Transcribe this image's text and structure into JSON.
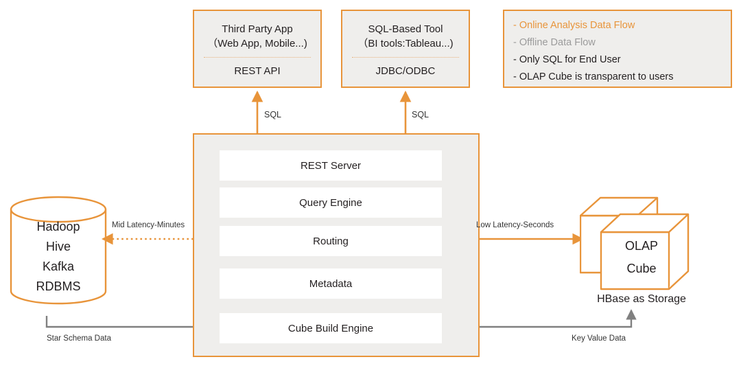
{
  "clients": [
    {
      "title_line1": "Third Party App",
      "title_line2": "（Web App, Mobile...)",
      "interface": "REST API",
      "arrow_label": "SQL"
    },
    {
      "title_line1": "SQL-Based Tool",
      "title_line2": "（BI tools:Tableau...)",
      "interface": "JDBC/ODBC",
      "arrow_label": "SQL"
    }
  ],
  "legend": {
    "items": [
      {
        "text": "- Online Analysis Data Flow",
        "color": "#e8943a",
        "arrow": "double-arrow-orange"
      },
      {
        "text": "- Offline Data Flow",
        "color": "#9b9b9b",
        "arrow": "double-arrow-gray"
      },
      {
        "text": "- Only SQL for End User",
        "color": "#231f20",
        "arrow": "none"
      },
      {
        "text": "- OLAP Cube is transparent to users",
        "color": "#231f20",
        "arrow": "none"
      }
    ]
  },
  "main_container": {
    "layers": [
      "REST Server",
      "Query Engine",
      "Routing",
      "Metadata",
      "Cube Build Engine"
    ]
  },
  "source_store": {
    "lines": [
      "Hadoop",
      "Hive",
      "Kafka",
      "RDBMS"
    ]
  },
  "olap_store": {
    "cube_line1": "OLAP",
    "cube_line2": "Cube",
    "storage_label": "HBase  as Storage"
  },
  "flows": {
    "mid_latency": "Mid Latency-Minutes",
    "low_latency": "Low Latency-Seconds",
    "star_schema": "Star Schema Data",
    "key_value": "Key Value Data"
  },
  "colors": {
    "accent_orange": "#e8943a",
    "gray_flow": "#808080",
    "panel_gray": "#efeeec",
    "panel_white": "#ffffff",
    "text_dark": "#231f20",
    "text_muted": "#9b9b9b"
  }
}
